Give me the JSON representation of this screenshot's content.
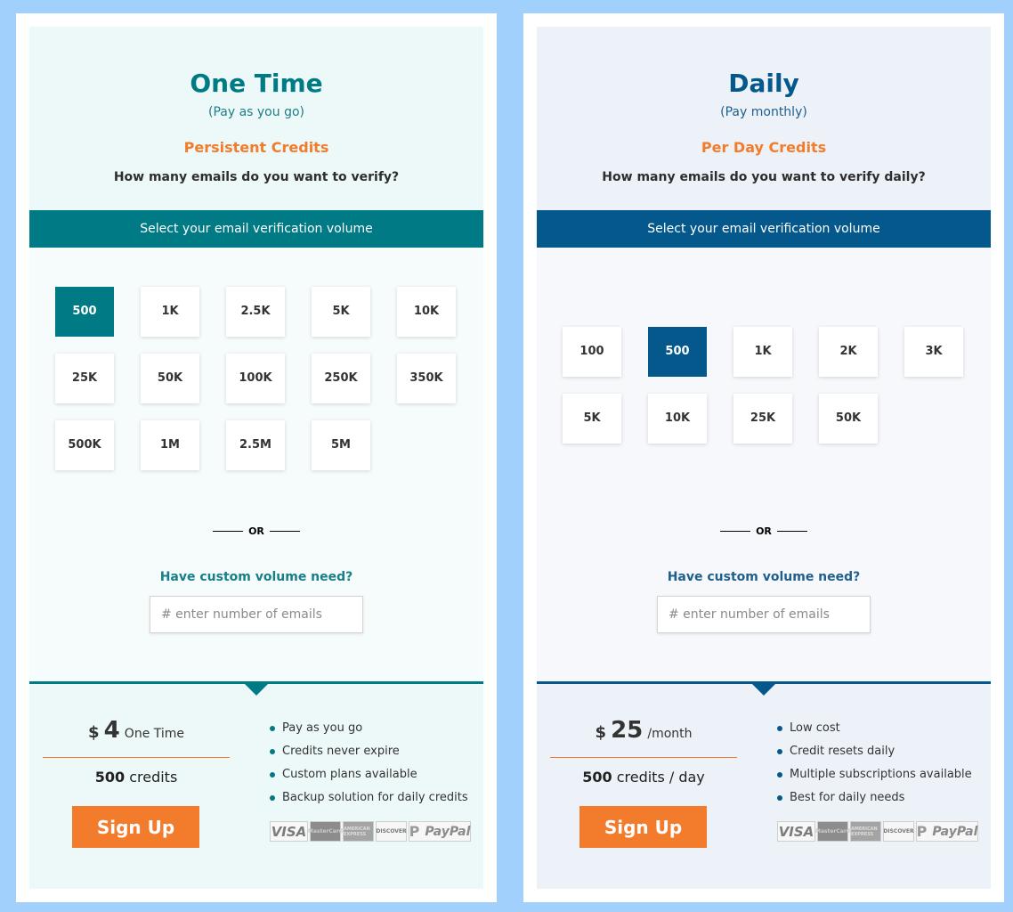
{
  "colors": {
    "page_background": "#a2d0fd",
    "one_time_accent": "#007b85",
    "daily_accent": "#05588b",
    "orange": "#f27c2c"
  },
  "plans": [
    {
      "title": "One Time",
      "subtitle": "(Pay as you go)",
      "credit_type": "Persistent Credits",
      "question": "How many emails do you want to verify?",
      "volume_bar": "Select your email verification volume",
      "volumes": [
        "500",
        "1K",
        "2.5K",
        "5K",
        "10K",
        "25K",
        "50K",
        "100K",
        "250K",
        "350K",
        "500K",
        "1M",
        "2.5M",
        "5M"
      ],
      "selected_volume": "500",
      "or_text": "OR",
      "custom_label": "Have custom volume need?",
      "custom_placeholder": "# enter number of emails",
      "custom_value": "",
      "price": {
        "currency": "$",
        "amount": "4",
        "period": "One Time"
      },
      "credits": {
        "count": "500",
        "unit": "credits"
      },
      "signup_label": "Sign Up",
      "features": [
        "Pay as you go",
        "Credits never expire",
        "Custom plans available",
        "Backup solution for daily credits"
      ],
      "payment_logos": [
        "VISA",
        "MasterCard",
        "AMERICAN EXPRESS",
        "DISCOVER",
        "PayPal"
      ]
    },
    {
      "title": "Daily",
      "subtitle": "(Pay monthly)",
      "credit_type": "Per Day Credits",
      "question": "How many emails do you want to verify daily?",
      "volume_bar": "Select your email verification volume",
      "volumes": [
        "100",
        "500",
        "1K",
        "2K",
        "3K",
        "5K",
        "10K",
        "25K",
        "50K"
      ],
      "selected_volume": "500",
      "or_text": "OR",
      "custom_label": "Have custom volume need?",
      "custom_placeholder": "# enter number of emails",
      "custom_value": "",
      "price": {
        "currency": "$",
        "amount": "25",
        "period": "/month"
      },
      "credits": {
        "count": "500",
        "unit": "credits / day"
      },
      "signup_label": "Sign Up",
      "features": [
        "Low cost",
        "Credit resets daily",
        "Multiple subscriptions available",
        "Best for daily needs"
      ],
      "payment_logos": [
        "VISA",
        "MasterCard",
        "AMERICAN EXPRESS",
        "DISCOVER",
        "PayPal"
      ]
    }
  ]
}
